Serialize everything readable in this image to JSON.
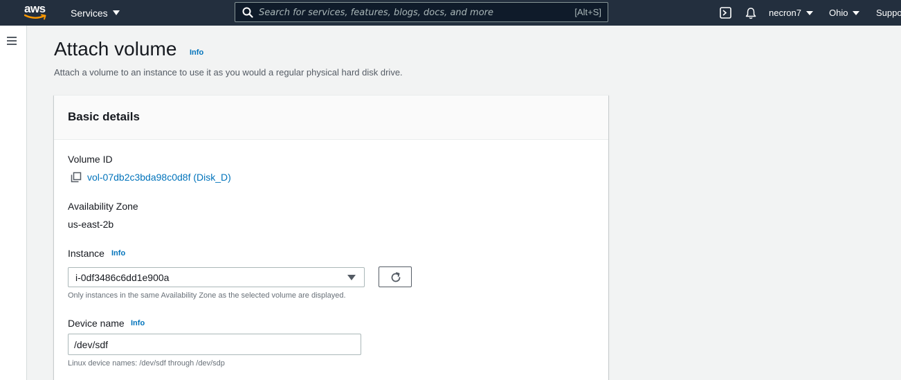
{
  "topnav": {
    "logo_text": "aws",
    "services_label": "Services",
    "search_placeholder": "Search for services, features, blogs, docs, and more",
    "search_shortcut": "[Alt+S]",
    "user": "necron7",
    "region": "Ohio",
    "support": "Support",
    "icons": [
      "cloudshell-icon",
      "bell-icon"
    ]
  },
  "page": {
    "title": "Attach volume",
    "title_info": "Info",
    "description": "Attach a volume to an instance to use it as you would a regular physical hard disk drive."
  },
  "panel": {
    "title": "Basic details",
    "volume_id_label": "Volume ID",
    "volume_id_value": "vol-07db2c3bda98c0d8f (Disk_D)",
    "az_label": "Availability Zone",
    "az_value": "us-east-2b",
    "instance_label": "Instance",
    "instance_info": "Info",
    "instance_value": "i-0df3486c6dd1e900a",
    "instance_hint": "Only instances in the same Availability Zone as the selected volume are displayed.",
    "device_label": "Device name",
    "device_info": "Info",
    "device_value": "/dev/sdf",
    "device_hint": "Linux device names: /dev/sdf through /dev/sdp"
  },
  "colors": {
    "nav_bg": "#232f3e",
    "link": "#0073bb",
    "aws_orange": "#ff9900"
  }
}
